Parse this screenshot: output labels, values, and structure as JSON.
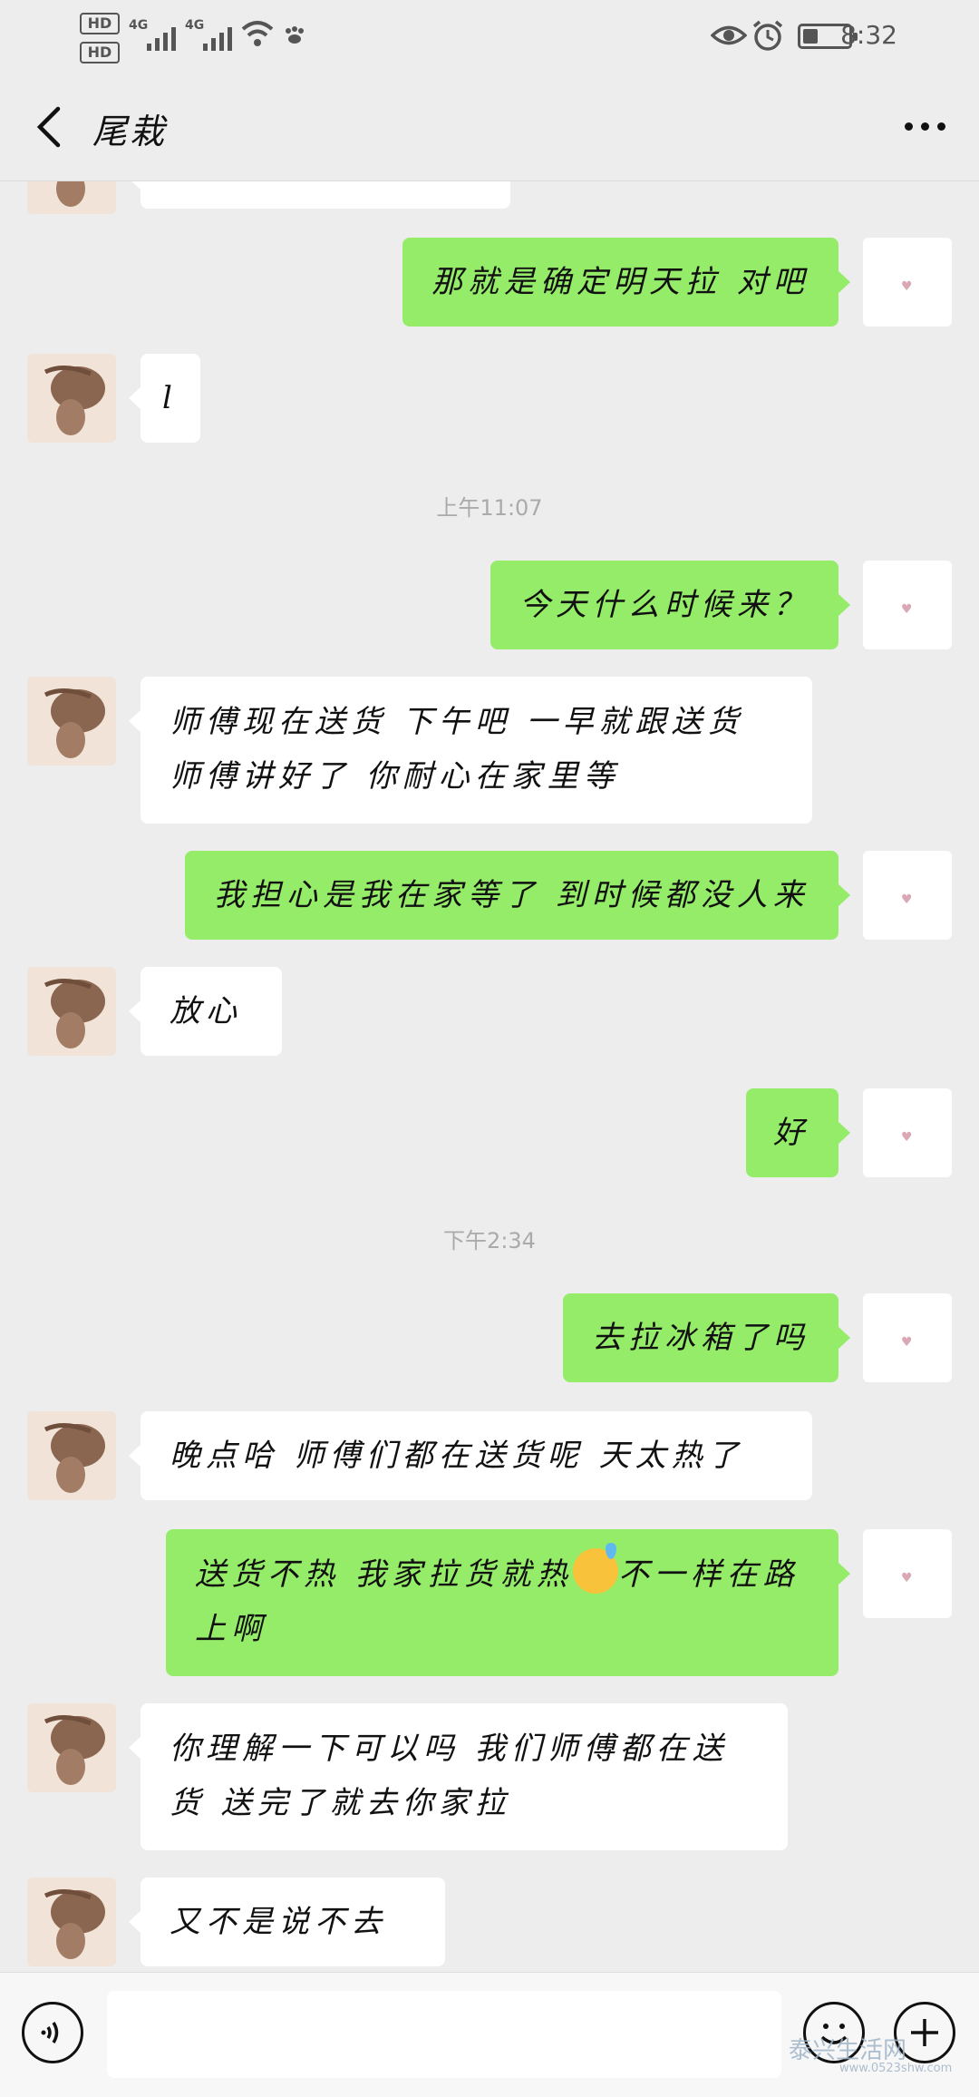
{
  "status_bar": {
    "hd1": "HD",
    "hd2": "HD",
    "sim1_network": "4G",
    "sim2_network": "4G",
    "time": "8:32",
    "battery_level_percent": 30,
    "icons": [
      "eye-icon",
      "alarm-icon",
      "wifi-icon",
      "paw-icon"
    ]
  },
  "header": {
    "title": "尾栽",
    "back_icon": "chevron-left-icon",
    "more_icon": "more-dots-icon"
  },
  "messages": [
    {
      "side": "out",
      "text": "那就是确定明天拉 对吧"
    },
    {
      "side": "in",
      "text": "l"
    },
    {
      "side": "time",
      "text": "上午11:07"
    },
    {
      "side": "out",
      "text": "今天什么时候来？"
    },
    {
      "side": "in",
      "line1": "师傅现在送货   下午吧  一早就跟送货",
      "line2": "师傅讲好了  你耐心在家里等"
    },
    {
      "side": "out",
      "text": "我担心是我在家等了 到时候都没人来"
    },
    {
      "side": "in",
      "text": "放心"
    },
    {
      "side": "out",
      "text": "好"
    },
    {
      "side": "time",
      "text": "下午2:34"
    },
    {
      "side": "out",
      "text": "去拉冰箱了吗"
    },
    {
      "side": "in",
      "text": "晚点哈  师傅们都在送货呢  天太热了"
    },
    {
      "side": "out",
      "line1a": "送货不热 我家拉货就热",
      "emoji": "sweat-smile-emoji",
      "line1b": "不一样在路",
      "line2": "上啊"
    },
    {
      "side": "in",
      "line1": "你理解一下可以吗  我们师傅都在送",
      "line2": "货      送完了就去你家拉"
    },
    {
      "side": "in",
      "text": "又不是说不去"
    }
  ],
  "input_bar": {
    "voice_icon": "voice-icon",
    "input_value": "",
    "emoji_icon": "emoji-icon",
    "plus_icon": "plus-icon"
  },
  "watermark": {
    "brand": "泰兴生活网",
    "url": "www.0523shw.com"
  },
  "colors": {
    "background": "#ededed",
    "outgoing_bubble": "#95ec69",
    "incoming_bubble": "#ffffff"
  }
}
